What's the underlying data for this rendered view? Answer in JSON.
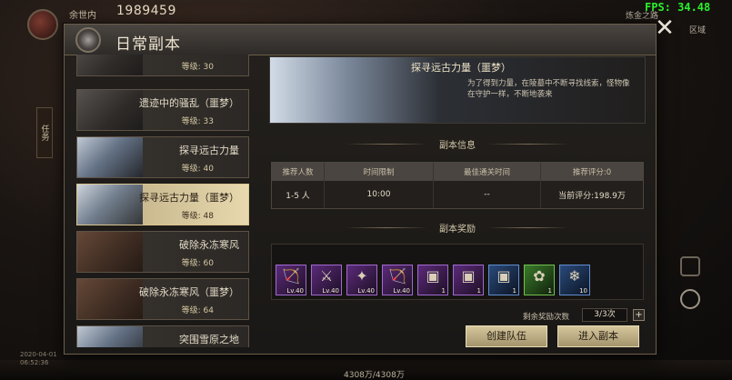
{
  "hud": {
    "player_name": "余世内",
    "power": "1989459",
    "fps": "FPS: 34.48",
    "zone": "炼金之路",
    "zone_sub": "区域",
    "side_tab": "任务",
    "bottom_exp": "4308万/4308万",
    "bottom_info": "2020-04-01\n06:52:36"
  },
  "panel": {
    "title": "日常副本",
    "close": "✕"
  },
  "dungeons": [
    {
      "name": "",
      "level": "等级: 30",
      "theme": "dark"
    },
    {
      "name": "遗迹中的骚乱（噩梦）",
      "level": "等级: 33",
      "theme": "dark"
    },
    {
      "name": "探寻远古力量",
      "level": "等级: 40",
      "theme": "ice"
    },
    {
      "name": "探寻远古力量（噩梦）",
      "level": "等级: 48",
      "theme": "ice",
      "selected": true
    },
    {
      "name": "破除永冻寒风",
      "level": "等级: 60",
      "theme": "fire"
    },
    {
      "name": "破除永冻寒风（噩梦）",
      "level": "等级: 64",
      "theme": "fire"
    },
    {
      "name": "突围雪原之地",
      "level": "",
      "theme": "ice"
    }
  ],
  "detail": {
    "title": "探寻远古力量（噩梦）",
    "description": "为了得到力量，在陵墓中不断寻找线索，怪物像在守护一样，不断地袭来",
    "info_section": "副本信息",
    "reward_section": "副本奖励",
    "table_headers": [
      "推荐人数",
      "时间限制",
      "最佳通关时间",
      "推荐评分:0"
    ],
    "table_values": [
      "1-5 人",
      "10:00",
      "--",
      "当前评分:198.9万"
    ],
    "rewards": [
      {
        "label": "Lv.40",
        "glyph": "🏹",
        "rarity": "purple"
      },
      {
        "label": "Lv.40",
        "glyph": "⚔",
        "rarity": "purple"
      },
      {
        "label": "Lv.40",
        "glyph": "✦",
        "rarity": "purple"
      },
      {
        "label": "Lv.40",
        "glyph": "🏹",
        "rarity": "purple"
      },
      {
        "label": "1",
        "glyph": "▣",
        "rarity": "purple"
      },
      {
        "label": "1",
        "glyph": "▣",
        "rarity": "purple"
      },
      {
        "label": "1",
        "glyph": "▣",
        "rarity": "blue"
      },
      {
        "label": "1",
        "glyph": "✿",
        "rarity": "green"
      },
      {
        "label": "10",
        "glyph": "❄",
        "rarity": "blue"
      }
    ],
    "remain_label": "剩余奖励次数",
    "remain_value": "3/3次",
    "plus": "+",
    "create_team": "创建队伍",
    "enter_dungeon": "进入副本"
  }
}
